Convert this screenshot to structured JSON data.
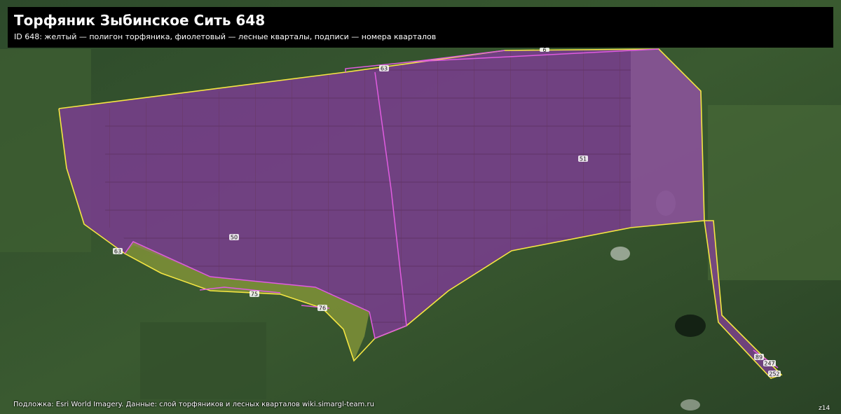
{
  "header": {
    "title": "Торфяник Зыбинское Сить 648",
    "subtitle": "ID 648: желтый — полигон торфяника, фиолетовый — лесные кварталы, подписи — номера кварталов"
  },
  "footer": {
    "attribution": "Подложка: Esri World Imagery. Данные: слой торфяников и лесных кварталов wiki.simargl-team.ru",
    "zoom": "z14"
  },
  "legend": {
    "peat_color": "#f5e642",
    "quarter_color": "#e05ce0",
    "quarter_fill": "#8a3fa0"
  },
  "quarter_labels": [
    "63",
    "51",
    "50",
    "63",
    "75",
    "76",
    "89",
    "247",
    "252",
    "6"
  ]
}
